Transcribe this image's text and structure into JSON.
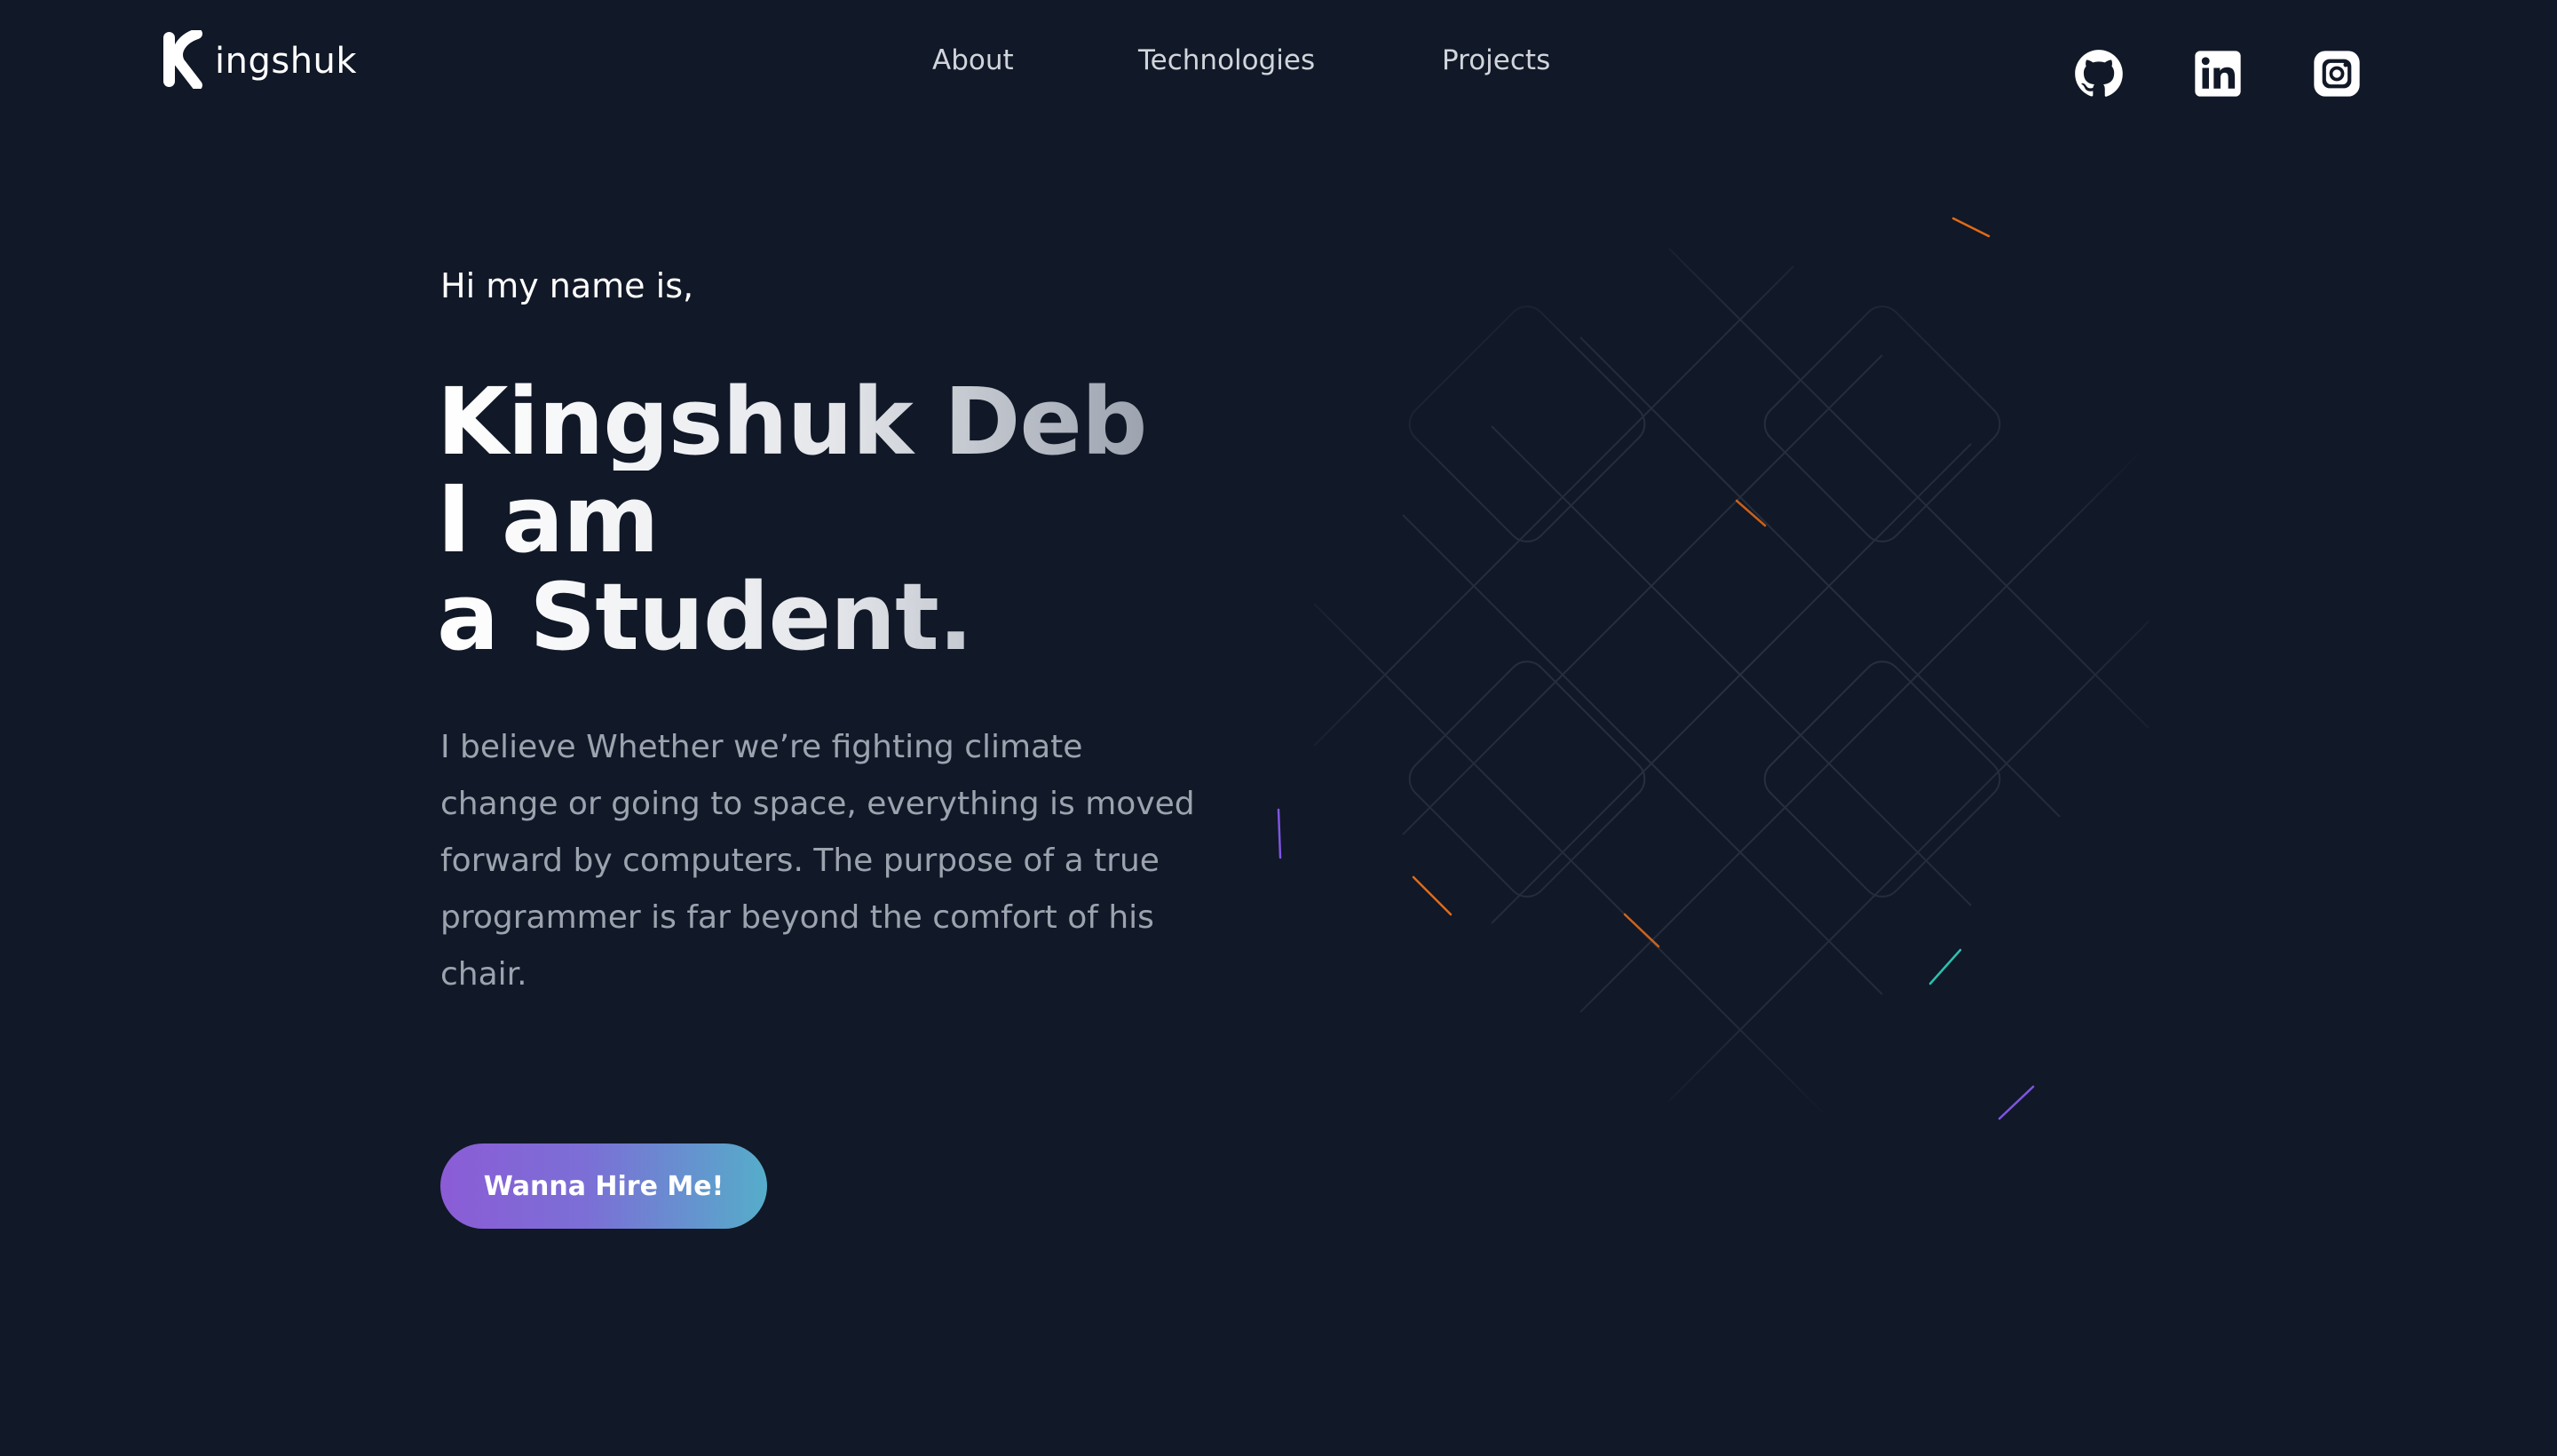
{
  "nav": {
    "logo_text": "ingshuk",
    "links": [
      {
        "label": "About"
      },
      {
        "label": "Technologies"
      },
      {
        "label": "Projects"
      }
    ],
    "socials": [
      {
        "name": "github-icon"
      },
      {
        "name": "linkedin-icon"
      },
      {
        "name": "instagram-icon"
      }
    ]
  },
  "hero": {
    "greeting": "Hi my name is,",
    "name": "Kingshuk Deb",
    "line2": "I am",
    "line3": "a Student.",
    "intro": "I believe Whether we’re fighting climate change or going to space, everything is moved forward by computers. The purpose of a true programmer is far beyond the comfort of his chair.",
    "cta_label": "Wanna Hire Me!"
  },
  "colors": {
    "background": "#111827",
    "nav_text": "#d1d5db",
    "intro_text": "#9ca3af",
    "cta_gradient_start": "#8b5cd6",
    "cta_gradient_end": "#55adca",
    "grid_line": "#2a3140",
    "spark_orange": "#f97316",
    "spark_teal": "#2dd4bf",
    "spark_violet": "#8b5cf6"
  }
}
